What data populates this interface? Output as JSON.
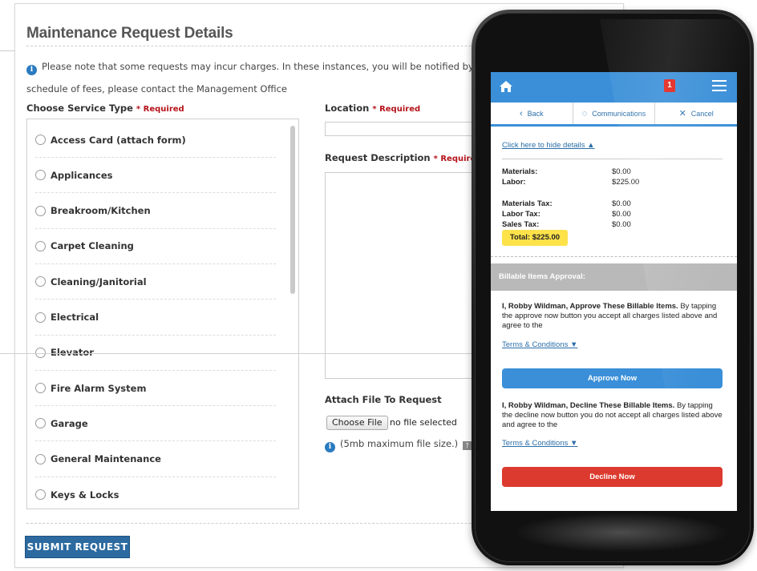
{
  "desktop": {
    "title": "Maintenance Request Details",
    "notice_line1": "Please note that some requests may incur charges. In these instances, you will be notified by the m",
    "notice_line2": "schedule of fees, please contact the Management Office",
    "service_label": "Choose Service Type",
    "required": "* Required",
    "services": [
      "Access Card (attach form)",
      "Applicances",
      "Breakroom/Kitchen",
      "Carpet Cleaning",
      "Cleaning/Janitorial",
      "Electrical",
      "Elevator",
      "Fire Alarm System",
      "Garage",
      "General Maintenance",
      "Keys & Locks"
    ],
    "location_label": "Location",
    "description_label": "Request Description",
    "attach_label": "Attach File To Request",
    "choose_file": "Choose File",
    "no_file": "no file selected",
    "file_note": "(5mb maximum file size.)",
    "submit": "SUBMIT REQUEST"
  },
  "phone": {
    "notification_count": "1",
    "nav": {
      "back": "Back",
      "communications": "Communications",
      "cancel": "Cancel"
    },
    "hide_details": "Click here to hide details ▲",
    "costs": [
      {
        "label": "Materials:",
        "value": "$0.00"
      },
      {
        "label": "Labor:",
        "value": "$225.00"
      },
      {
        "label": "Materials Tax:",
        "value": "$0.00"
      },
      {
        "label": "Labor Tax:",
        "value": "$0.00"
      },
      {
        "label": "Sales Tax:",
        "value": "$0.00"
      }
    ],
    "total": "Total: $225.00",
    "approval_header": "Billable Items Approval:",
    "approve_bold": "I, Robby Wildman, Approve These Billable Items.",
    "approve_text": " By tapping the approve now button you accept all charges listed above and agree to the",
    "terms": "Terms & Conditions ▼",
    "approve_button": "Approve Now",
    "decline_bold": "I, Robby Wildman, Decline These Billable Items.",
    "decline_text": " By tapping the decline now button you do not accept all charges listed above and agree to the",
    "decline_button": "Decline Now"
  },
  "colors": {
    "accent": "#3a8fd8",
    "submit": "#2c6aa0",
    "decline": "#dc3a2e",
    "total_highlight": "#fde24a",
    "required": "#b5131a"
  }
}
